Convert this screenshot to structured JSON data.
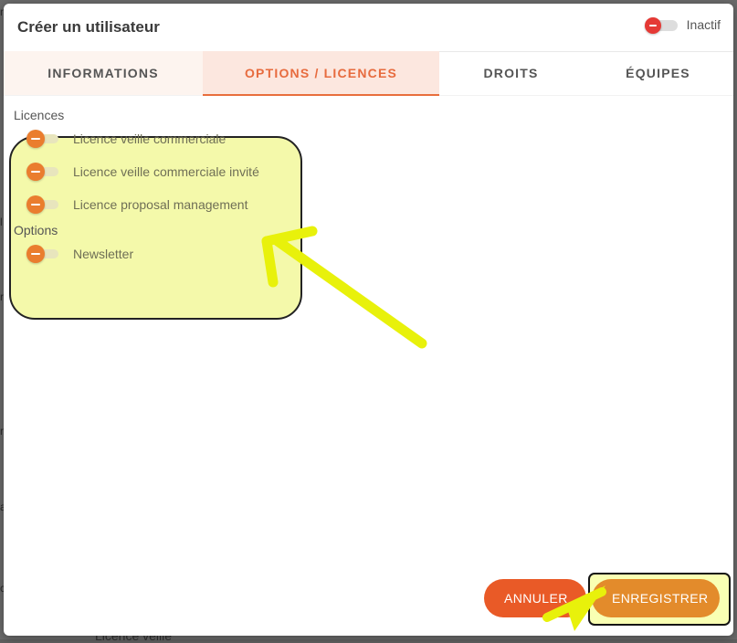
{
  "dialog": {
    "title": "Créer un utilisateur",
    "status_label": "Inactif"
  },
  "tabs": [
    {
      "label": "INFORMATIONS"
    },
    {
      "label": "OPTIONS / LICENCES"
    },
    {
      "label": "DROITS"
    },
    {
      "label": "ÉQUIPES"
    }
  ],
  "licences": {
    "section_label": "Licences",
    "items": [
      {
        "label": "Licence veille commerciale"
      },
      {
        "label": "Licence veille commerciale invité"
      },
      {
        "label": "Licence proposal management"
      }
    ]
  },
  "options": {
    "section_label": "Options",
    "items": [
      {
        "label": "Newsletter"
      }
    ]
  },
  "actions": {
    "cancel_label": "ANNULER",
    "save_label": "ENREGISTRER"
  },
  "background": {
    "peek_text": "Licence veille"
  },
  "colors": {
    "accent_orange": "#e76b3e",
    "toggle_thumb": "#ea7d2e",
    "highlight_yellow": "#eef46f"
  }
}
